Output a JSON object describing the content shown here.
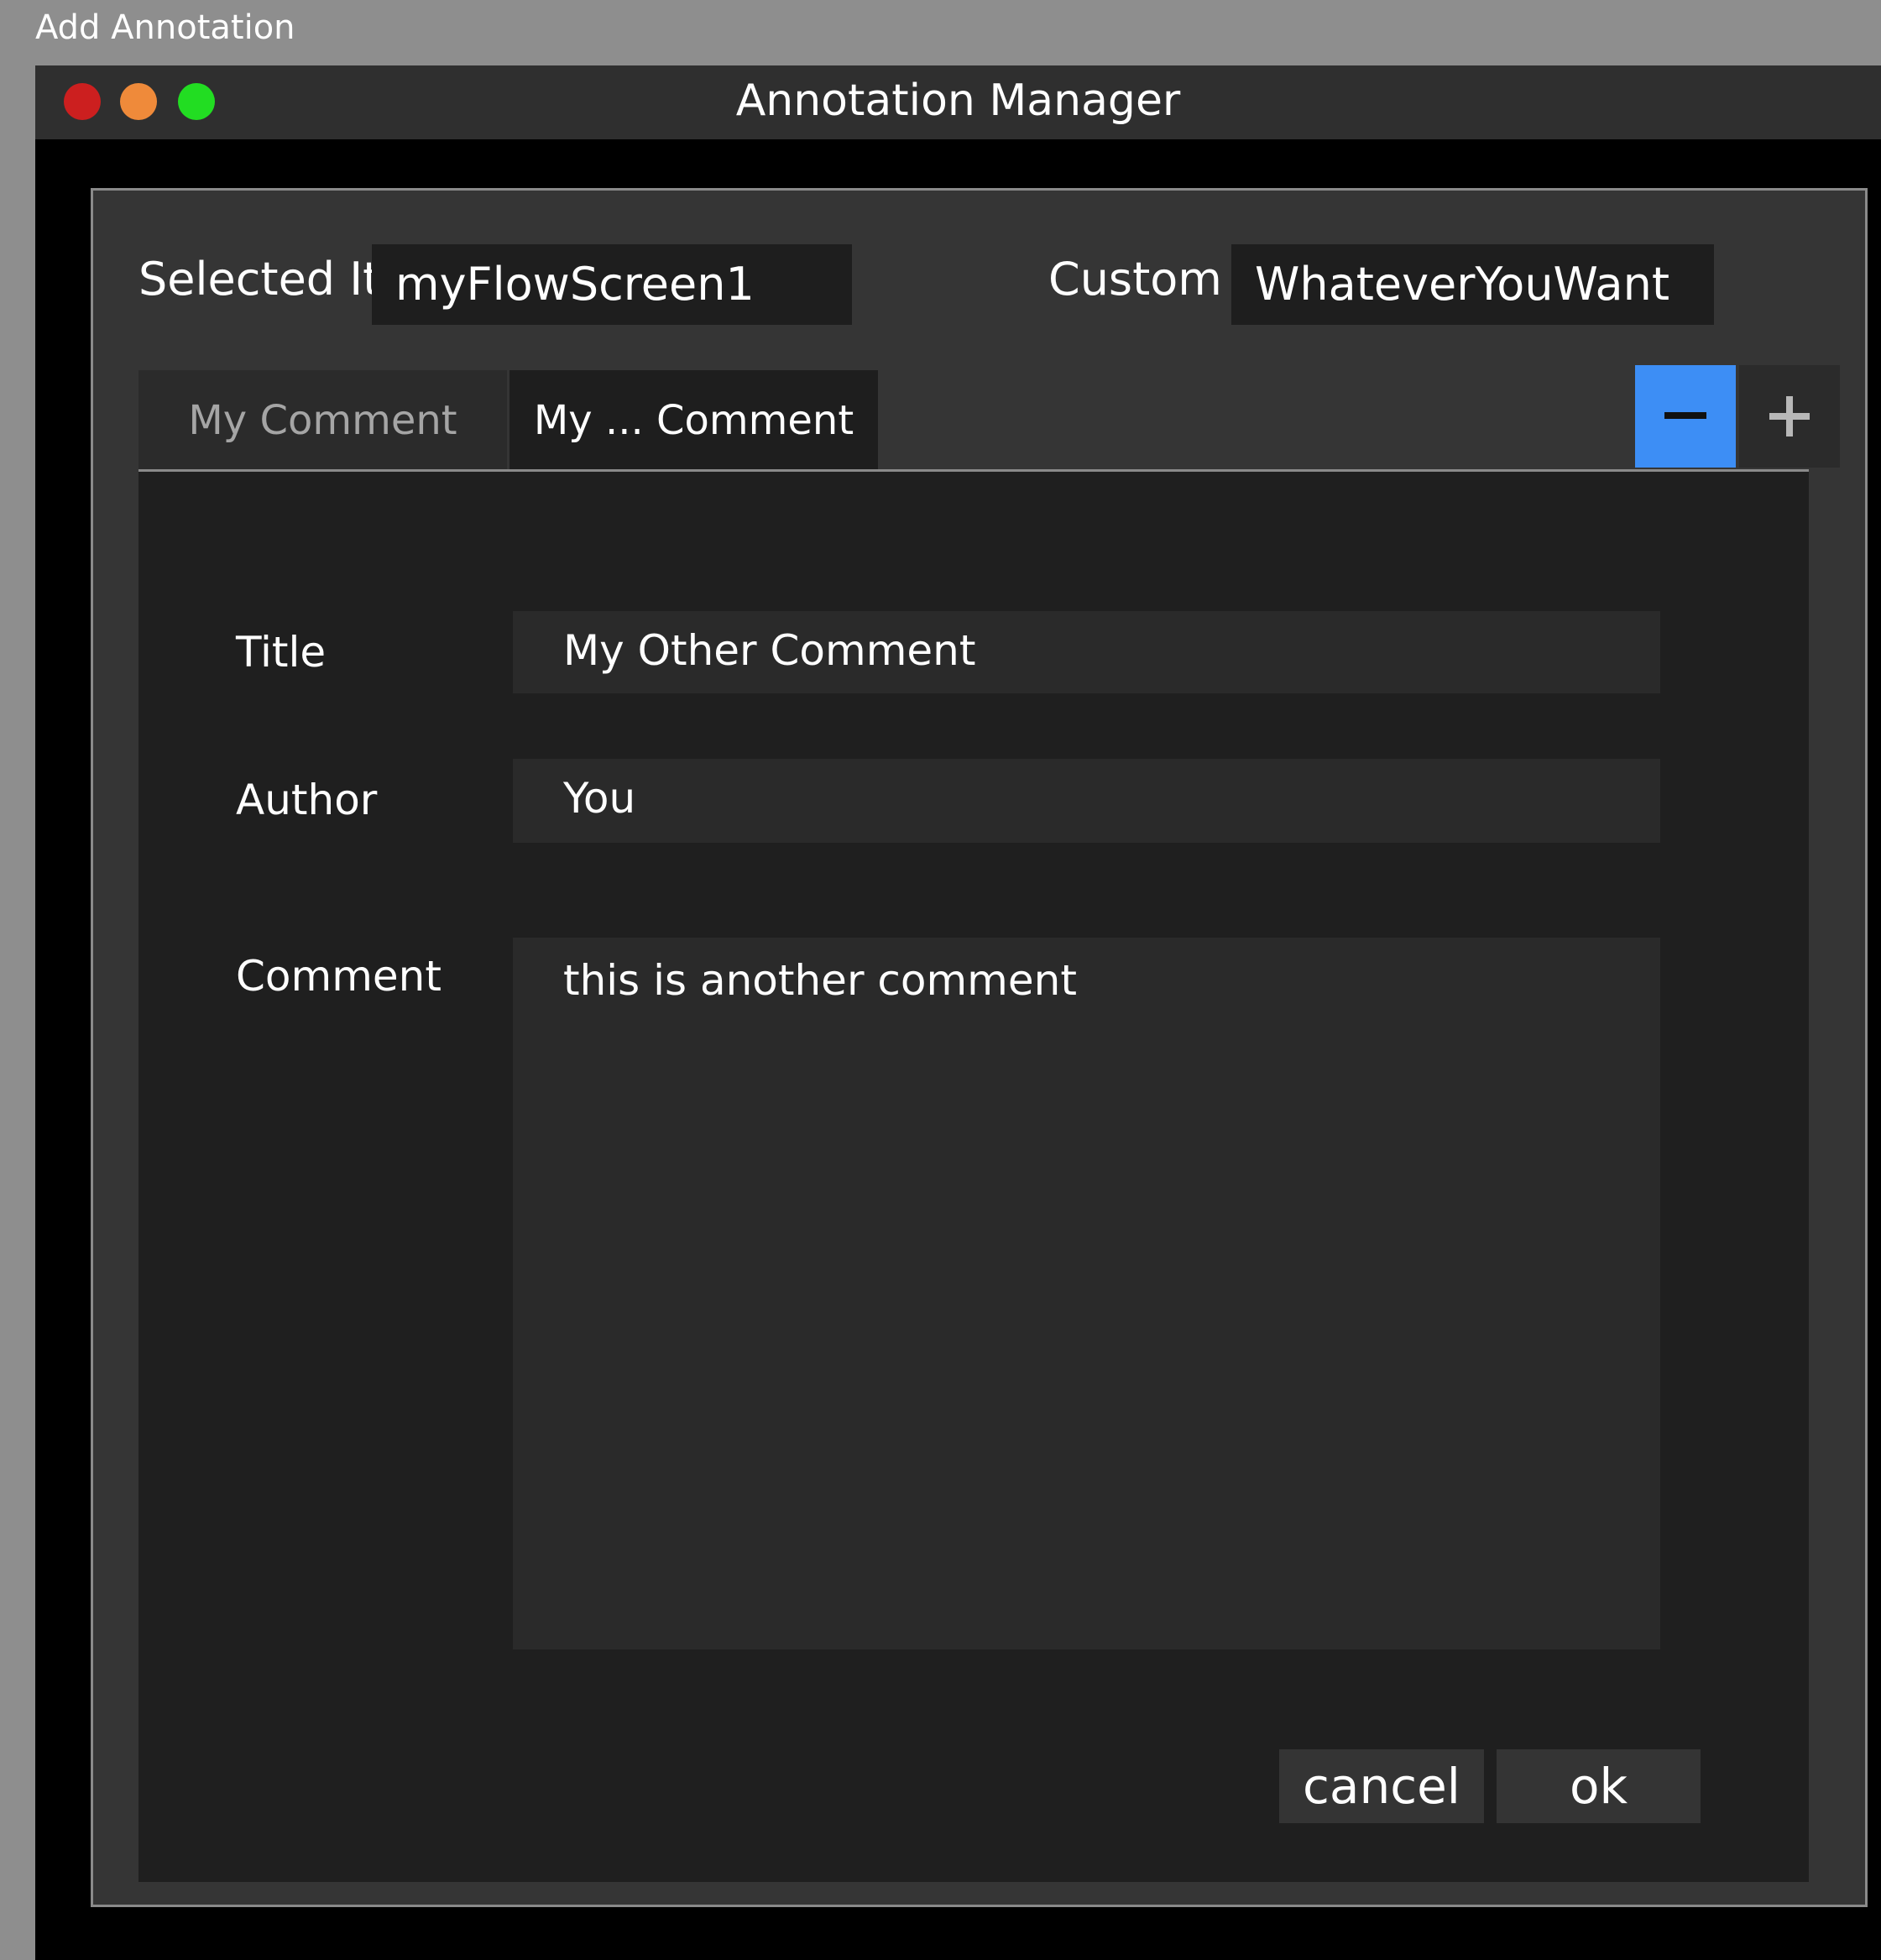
{
  "caption": "Add Annotation",
  "window": {
    "title": "Annotation Manager"
  },
  "form": {
    "selected_item_label": "Selected Item",
    "selected_item_value": "myFlowScreen1",
    "custom_id_label": "Custom ID",
    "custom_id_value": "WhateverYouWant"
  },
  "tabs": [
    {
      "label": "My Comment",
      "active": false
    },
    {
      "label": "My ... Comment",
      "active": true
    }
  ],
  "icons": {
    "remove": "minus-icon",
    "add": "plus-icon"
  },
  "comment": {
    "title_label": "Title",
    "title_value": "My  Other Comment",
    "author_label": "Author",
    "author_value": "You",
    "comment_label": "Comment",
    "comment_value": "this is another comment"
  },
  "buttons": {
    "cancel": "cancel",
    "ok": "ok"
  },
  "colors": {
    "accent": "#3d8ef5",
    "close": "#cc1f1f",
    "minimize": "#ef8a3a",
    "maximize": "#22dd22"
  }
}
